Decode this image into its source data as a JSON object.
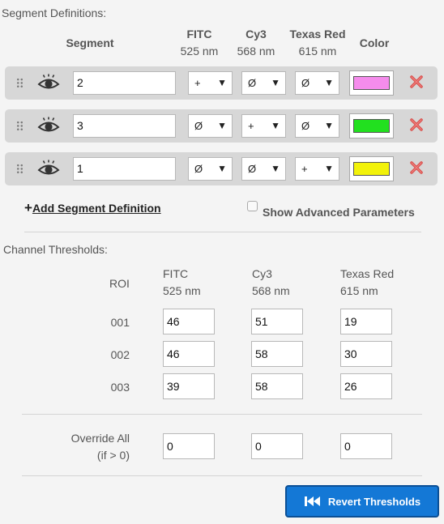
{
  "segment_section": {
    "title": "Segment Definitions:",
    "headers": {
      "segment": "Segment",
      "fitc_name": "FITC",
      "fitc_nm": "525 nm",
      "cy3_name": "Cy3",
      "cy3_nm": "568 nm",
      "tr_name": "Texas Red",
      "tr_nm": "615 nm",
      "color": "Color"
    },
    "rows": [
      {
        "segment": "2",
        "fitc": "+",
        "cy3": "Ø",
        "texas_red": "Ø",
        "color": "#f58cec"
      },
      {
        "segment": "3",
        "fitc": "Ø",
        "cy3": "+",
        "texas_red": "Ø",
        "color": "#22e01f"
      },
      {
        "segment": "1",
        "fitc": "Ø",
        "cy3": "Ø",
        "texas_red": "+",
        "color": "#f2f20a"
      }
    ],
    "add_label": "Add Segment Definition",
    "add_prefix": "+",
    "advanced_label": "Show Advanced Parameters",
    "advanced_checked": false
  },
  "threshold_section": {
    "title": "Channel Thresholds:",
    "headers": {
      "roi": "ROI",
      "fitc_name": "FITC",
      "fitc_nm": "525 nm",
      "cy3_name": "Cy3",
      "cy3_nm": "568 nm",
      "tr_name": "Texas Red",
      "tr_nm": "615 nm"
    },
    "rows": [
      {
        "roi": "001",
        "fitc": "46",
        "cy3": "51",
        "texas_red": "19"
      },
      {
        "roi": "002",
        "fitc": "46",
        "cy3": "58",
        "texas_red": "30"
      },
      {
        "roi": "003",
        "fitc": "39",
        "cy3": "58",
        "texas_red": "26"
      }
    ],
    "override_label_1": "Override All",
    "override_label_2": "(if > 0)",
    "override": {
      "fitc": "0",
      "cy3": "0",
      "texas_red": "0"
    },
    "revert_label": "Revert Thresholds"
  },
  "icons": {
    "grip": "drag-handle-icon",
    "eye": "eye-icon",
    "delete": "delete-x-icon",
    "revert": "rewind-icon",
    "caret": "caret-down-icon"
  },
  "colors": {
    "accent": "#1478d6",
    "delete": "#d9534f",
    "row_bg": "#d7d7d7"
  }
}
